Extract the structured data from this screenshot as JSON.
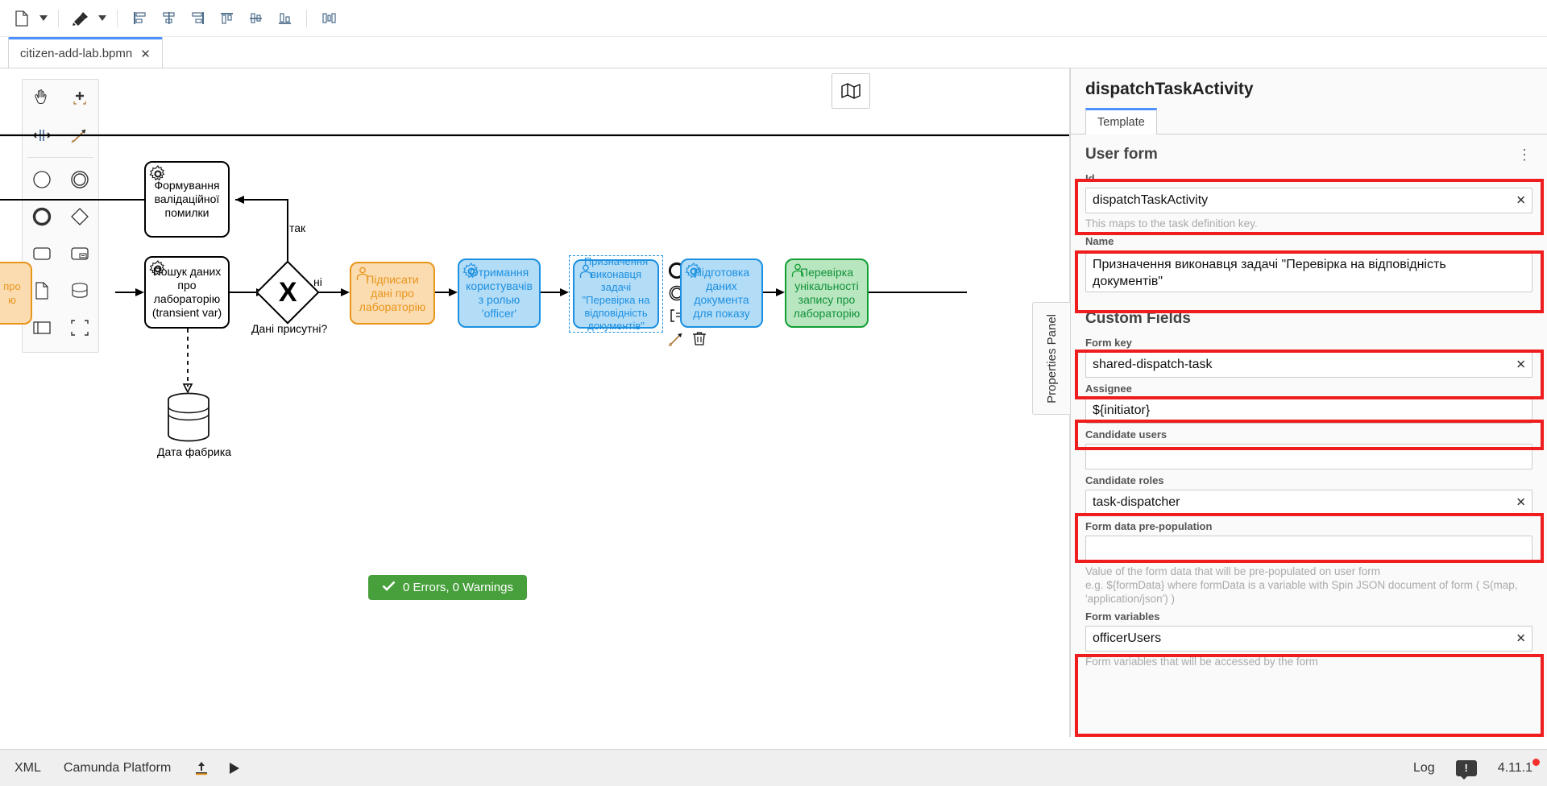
{
  "toolbar": {
    "buttons": [
      {
        "name": "new-file-button",
        "icon": "file-icon"
      },
      {
        "name": "new-file-dropdown",
        "icon": "caret-down-icon"
      },
      {
        "name": "format-paint-button",
        "icon": "paintbrush-icon"
      },
      {
        "name": "format-paint-dropdown",
        "icon": "caret-down-icon"
      },
      {
        "name": "align-left-button",
        "icon": "align-left-icon"
      },
      {
        "name": "align-center-button",
        "icon": "align-center-icon"
      },
      {
        "name": "align-right-button",
        "icon": "align-right-icon"
      },
      {
        "name": "align-top-button",
        "icon": "align-top-icon"
      },
      {
        "name": "align-middle-button",
        "icon": "align-middle-icon"
      },
      {
        "name": "align-bottom-button",
        "icon": "align-bottom-icon"
      },
      {
        "name": "distribute-horizontal-button",
        "icon": "distribute-horizontal-icon"
      }
    ]
  },
  "tab": {
    "label": "citizen-add-lab.bpmn",
    "close": "✕"
  },
  "canvas": {
    "palette": [
      {
        "name": "palette-hand-tool",
        "icon": "hand-icon"
      },
      {
        "name": "palette-lasso-tool",
        "icon": "lasso-icon"
      },
      {
        "name": "palette-space-tool",
        "icon": "space-tool-icon"
      },
      {
        "name": "palette-connect-tool",
        "icon": "connect-icon"
      },
      {
        "name": "palette-start-event",
        "icon": "circle-icon"
      },
      {
        "name": "palette-intermediate-event",
        "icon": "double-circle-icon"
      },
      {
        "name": "palette-end-event",
        "icon": "thick-circle-icon"
      },
      {
        "name": "palette-gateway",
        "icon": "diamond-icon"
      },
      {
        "name": "palette-task",
        "icon": "rounded-rect-icon"
      },
      {
        "name": "palette-subprocess-expanded",
        "icon": "subprocess-icon"
      },
      {
        "name": "palette-data-object",
        "icon": "data-object-icon"
      },
      {
        "name": "palette-data-store",
        "icon": "data-store-icon"
      },
      {
        "name": "palette-participant",
        "icon": "participant-icon"
      },
      {
        "name": "palette-group",
        "icon": "group-icon"
      }
    ],
    "minimap_icon": "map-icon",
    "nodes": [
      {
        "id": "n1",
        "label": "Формування валідаційної помилки",
        "type": "service-task",
        "color": "white"
      },
      {
        "id": "n2",
        "label": "Пошук даних про лабораторію (transient var)",
        "type": "service-task",
        "color": "white"
      },
      {
        "id": "n3",
        "label": "Дані присутні?",
        "type": "exclusive-gateway",
        "marker": "X"
      },
      {
        "id": "n4",
        "label": "Підписати дані про лабораторію",
        "type": "user-task",
        "color": "orange"
      },
      {
        "id": "n5",
        "label": "Отримання користувачів з ролью 'officer'",
        "type": "service-task",
        "color": "blue"
      },
      {
        "id": "n6",
        "label": "Призначення виконавця задачі \"Перевірка на відповідність документів\"",
        "type": "user-task",
        "color": "blue",
        "selected": true
      },
      {
        "id": "n7",
        "label": "Підготовка даних документа для показу",
        "type": "service-task",
        "color": "blue"
      },
      {
        "id": "n8",
        "label": "Перевірка унікальності запису про лабораторію",
        "type": "user-task",
        "color": "green"
      },
      {
        "id": "n9",
        "label": "Дата фабрика",
        "type": "data-store"
      }
    ],
    "flow_labels": [
      "так",
      "ні"
    ],
    "context_pad_icons": [
      "append-end-event-icon",
      "append-gateway-icon",
      "append-task-icon",
      "append-intermediate-event-icon",
      "change-type-icon",
      "delete-icon",
      "append-text-annotation-icon",
      "connect-icon"
    ],
    "status": {
      "icon": "check-icon",
      "text": "0 Errors, 0 Warnings"
    }
  },
  "properties_panel": {
    "handle_label": "Properties Panel",
    "title": "dispatchTaskActivity",
    "tabs": [
      {
        "label": "Template",
        "active": true
      }
    ],
    "groups": [
      {
        "heading": "User form",
        "menu_icon": "more-vertical-icon",
        "fields": [
          {
            "label": "Id",
            "value": "dispatchTaskActivity",
            "hint": "This maps to the task definition key.",
            "clear": "✕",
            "highlighted": true,
            "type": "text"
          },
          {
            "label": "Name",
            "value": "Призначення виконавця задачі \"Перевірка на відповідність документів\"",
            "hint": "",
            "highlighted": true,
            "type": "textarea"
          }
        ]
      },
      {
        "heading": "Custom Fields",
        "menu_icon": "",
        "fields": [
          {
            "label": "Form key",
            "value": "shared-dispatch-task",
            "hint": "",
            "clear": "✕",
            "highlighted": true,
            "type": "text"
          },
          {
            "label": "Assignee",
            "value": "${initiator}",
            "hint": "",
            "clear": "",
            "highlighted": true,
            "type": "text"
          },
          {
            "label": "Candidate users",
            "value": "",
            "hint": "",
            "clear": "",
            "highlighted": false,
            "type": "text"
          },
          {
            "label": "Candidate roles",
            "value": "task-dispatcher",
            "hint": "",
            "clear": "✕",
            "highlighted": true,
            "type": "text"
          },
          {
            "label": "Form data pre-population",
            "value": "",
            "hint": "Value of the form data that will be pre-populated on user form\ne.g. ${formData} where formData is a variable with Spin JSON document of form ( S(map, 'application/json') )",
            "clear": "",
            "highlighted": false,
            "type": "text"
          },
          {
            "label": "Form variables",
            "value": "officerUsers",
            "hint": "Form variables that will be accessed by the form",
            "clear": "✕",
            "highlighted": true,
            "type": "text"
          }
        ]
      }
    ]
  },
  "statusbar": {
    "xml_label": "XML",
    "platform_label": "Camunda Platform",
    "deploy_icon": "deploy-upload-icon",
    "run_icon": "play-icon",
    "log_label": "Log",
    "notification_icon": "notification-icon",
    "version": "4.11.1"
  },
  "colors": {
    "accent": "#4d90ff",
    "highlight": "#ef1d1d",
    "success": "#48a03c",
    "orange": "#e8941a",
    "blue": "#1c90e0",
    "green": "#119e33"
  }
}
